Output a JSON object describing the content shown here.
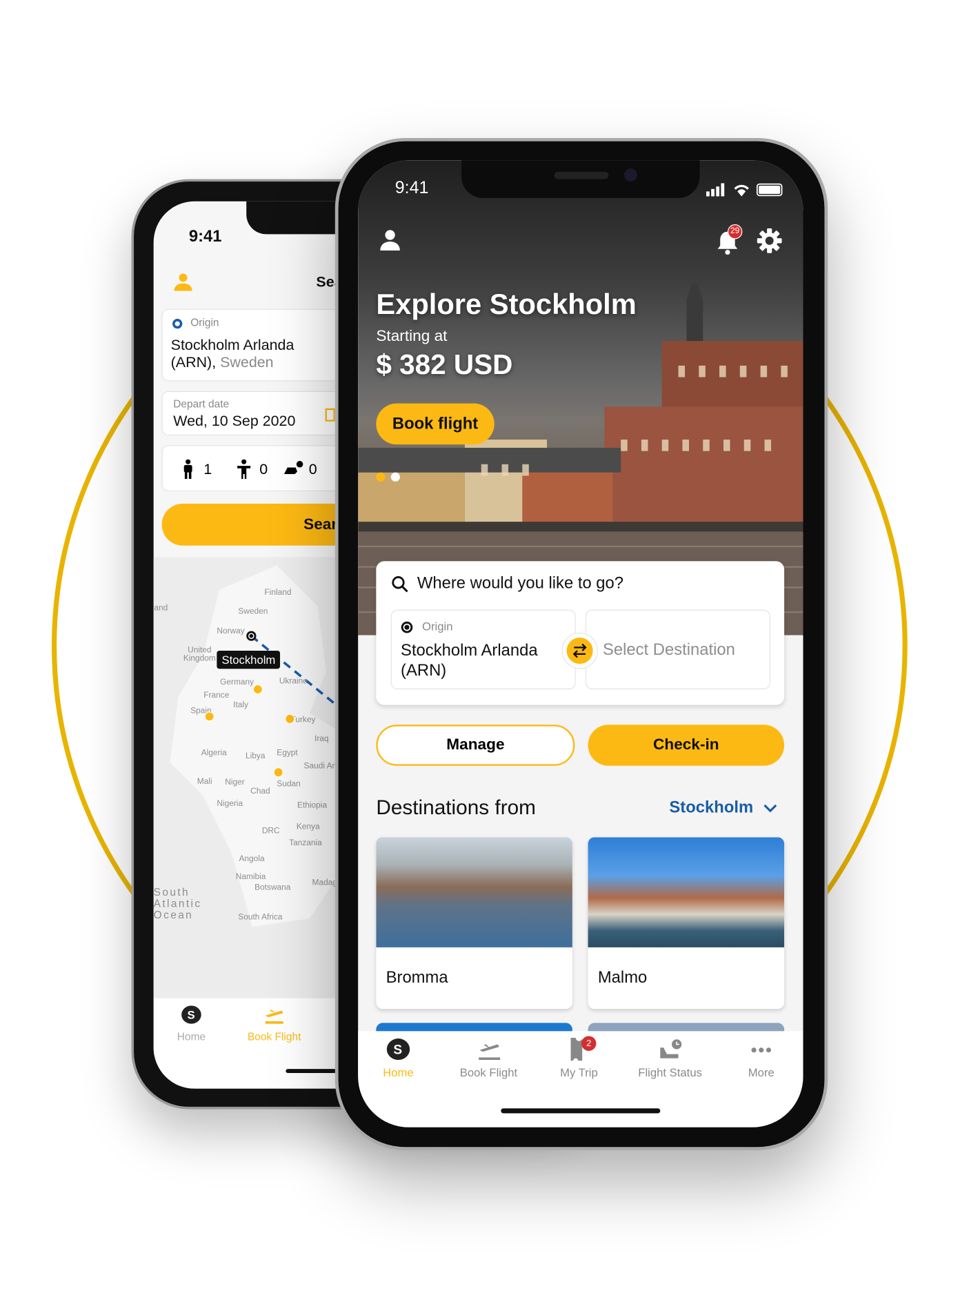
{
  "colors": {
    "accent": "#fdb913",
    "link": "#1a5ca8",
    "badge": "#d32f2f",
    "ring": "#e8b400"
  },
  "back_phone": {
    "status_time": "9:41",
    "header_partial": "Search",
    "origin": {
      "label": "Origin",
      "value": "Stockholm Arlanda (ARN),",
      "country": "Sweden"
    },
    "depart": {
      "label": "Depart date",
      "value": "Wed, 10 Sep 2020"
    },
    "passengers": {
      "adults": "1",
      "children": "0",
      "infants": "0"
    },
    "search_button": "Search",
    "map": {
      "labels": [
        "Iceland",
        "Finland",
        "Sweden",
        "Norway",
        "United Kingdom",
        "Germany",
        "Ukraine",
        "France",
        "Italy",
        "Spain",
        "Turkey",
        "Iraq",
        "Algeria",
        "Libya",
        "Egypt",
        "Saudi Arabia",
        "Mali",
        "Niger",
        "Chad",
        "Sudan",
        "Nigeria",
        "Ethiopia",
        "Kenya",
        "DRC",
        "Tanzania",
        "Angola",
        "Namibia",
        "Botswana",
        "Madagascar",
        "South Atlantic Ocean",
        "South Africa"
      ],
      "pin_tooltip": "Stockholm"
    },
    "tabs": [
      {
        "label": "Home",
        "icon": "brand-s-icon",
        "active": false
      },
      {
        "label": "Book Flight",
        "icon": "plane-takeoff-icon",
        "active": true
      }
    ]
  },
  "front_phone": {
    "status_time": "9:41",
    "notification_count": "29",
    "hero": {
      "title": "Explore Stockholm",
      "subtitle": "Starting at",
      "price": "$ 382 USD",
      "cta": "Book flight",
      "carousel_pages": 2,
      "carousel_active": 1
    },
    "search": {
      "prompt": "Where would you like to go?",
      "origin_label": "Origin",
      "origin_value": "Stockholm Arlanda (ARN)",
      "destination_placeholder": "Select Destination"
    },
    "actions": {
      "manage": "Manage",
      "checkin": "Check-in"
    },
    "destinations": {
      "heading": "Destinations from",
      "city": "Stockholm",
      "items": [
        {
          "name": "Bromma"
        },
        {
          "name": "Malmo"
        }
      ]
    },
    "tabs": [
      {
        "label": "Home",
        "icon": "brand-s-icon",
        "active": true
      },
      {
        "label": "Book Flight",
        "icon": "plane-takeoff-icon"
      },
      {
        "label": "My Trip",
        "icon": "ticket-icon",
        "badge": "2"
      },
      {
        "label": "Flight Status",
        "icon": "plane-landing-clock-icon"
      },
      {
        "label": "More",
        "icon": "more-dots-icon"
      }
    ]
  }
}
